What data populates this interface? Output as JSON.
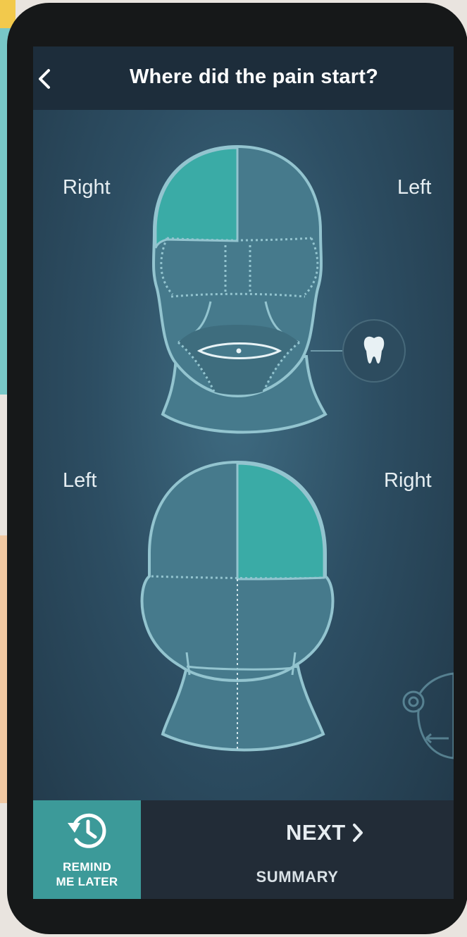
{
  "header": {
    "back_icon": "chevron-left-icon",
    "title": "Where did the pain start?"
  },
  "front_view": {
    "left_side_label": "Right",
    "right_side_label": "Left",
    "selected_region": "upper-right-forehead",
    "dental_icon": "tooth-icon"
  },
  "back_view": {
    "left_side_label": "Left",
    "right_side_label": "Right",
    "selected_region": "upper-right-crown"
  },
  "gesture_hint_icon": "swipe-hand-icon",
  "footer": {
    "remind_icon": "history-clock-icon",
    "remind_label_line1": "REMIND",
    "remind_label_line2": "ME LATER",
    "next_label": "NEXT",
    "next_icon": "chevron-right-icon",
    "summary_label": "SUMMARY"
  },
  "colors": {
    "selected": "#3aaba6",
    "region": "#467a8c",
    "outline": "#93c4cf",
    "header_bg": "#1d2d3b",
    "footer_bg": "#222c37",
    "remind_bg": "#3c9a99"
  }
}
